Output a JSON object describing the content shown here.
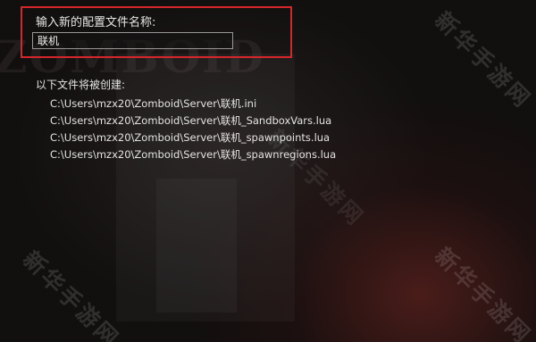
{
  "dialog": {
    "prompt_label": "输入新的配置文件名称:",
    "name_input_value": "联机"
  },
  "files": {
    "heading": "以下文件将被创建:",
    "paths": [
      "C:\\Users\\mzx20\\Zomboid\\Server\\联机.ini",
      "C:\\Users\\mzx20\\Zomboid\\Server\\联机_SandboxVars.lua",
      "C:\\Users\\mzx20\\Zomboid\\Server\\联机_spawnpoints.lua",
      "C:\\Users\\mzx20\\Zomboid\\Server\\联机_spawnregions.lua"
    ]
  },
  "background": {
    "logo_text": "ZOMBOID"
  },
  "watermark": {
    "text": "新华手游网"
  },
  "colors": {
    "highlight_border": "#d6262a",
    "text": "#e4e2e2"
  }
}
